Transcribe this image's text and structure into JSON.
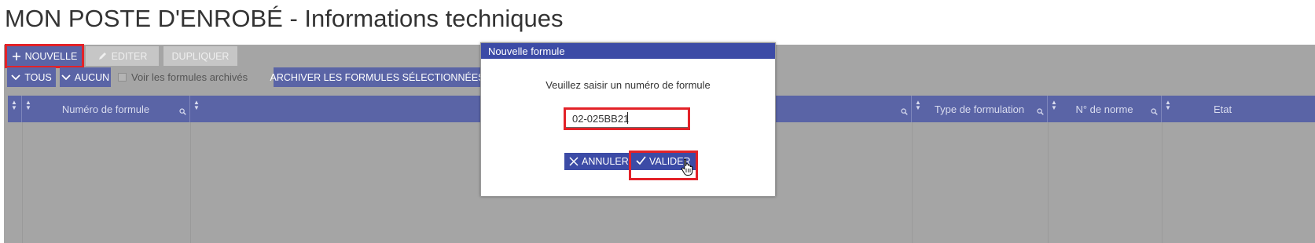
{
  "page": {
    "title": "MON POSTE D'ENROBÉ - Informations techniques"
  },
  "toolbar": {
    "new_label": "NOUVELLE",
    "edit_label": "EDITER",
    "duplicate_label": "DUPLIQUER",
    "all_label": "TOUS",
    "none_label": "AUCUN",
    "show_archived_label": "Voir les formules archivés",
    "archive_selected_label": "ARCHIVER LES FORMULES SÉLECTIONNÉES"
  },
  "table": {
    "columns": [
      "Numéro de formule",
      "",
      "Type de formulation",
      "N° de norme",
      "Etat"
    ]
  },
  "dialog": {
    "title": "Nouvelle formule",
    "message": "Veuillez saisir un numéro de formule",
    "input_value": "02-025BB21",
    "cancel_label": "ANNULER",
    "validate_label": "VALIDER"
  },
  "colors": {
    "accent": "#5a64a6",
    "dialog_accent": "#3c4ba6",
    "highlight": "#e32228",
    "overlay": "#a5a5a5"
  },
  "icons": [
    "plus-icon",
    "pencil-icon",
    "chevron-down-icon",
    "sort-icon",
    "search-icon",
    "close-icon",
    "check-icon",
    "hand-cursor-icon"
  ]
}
